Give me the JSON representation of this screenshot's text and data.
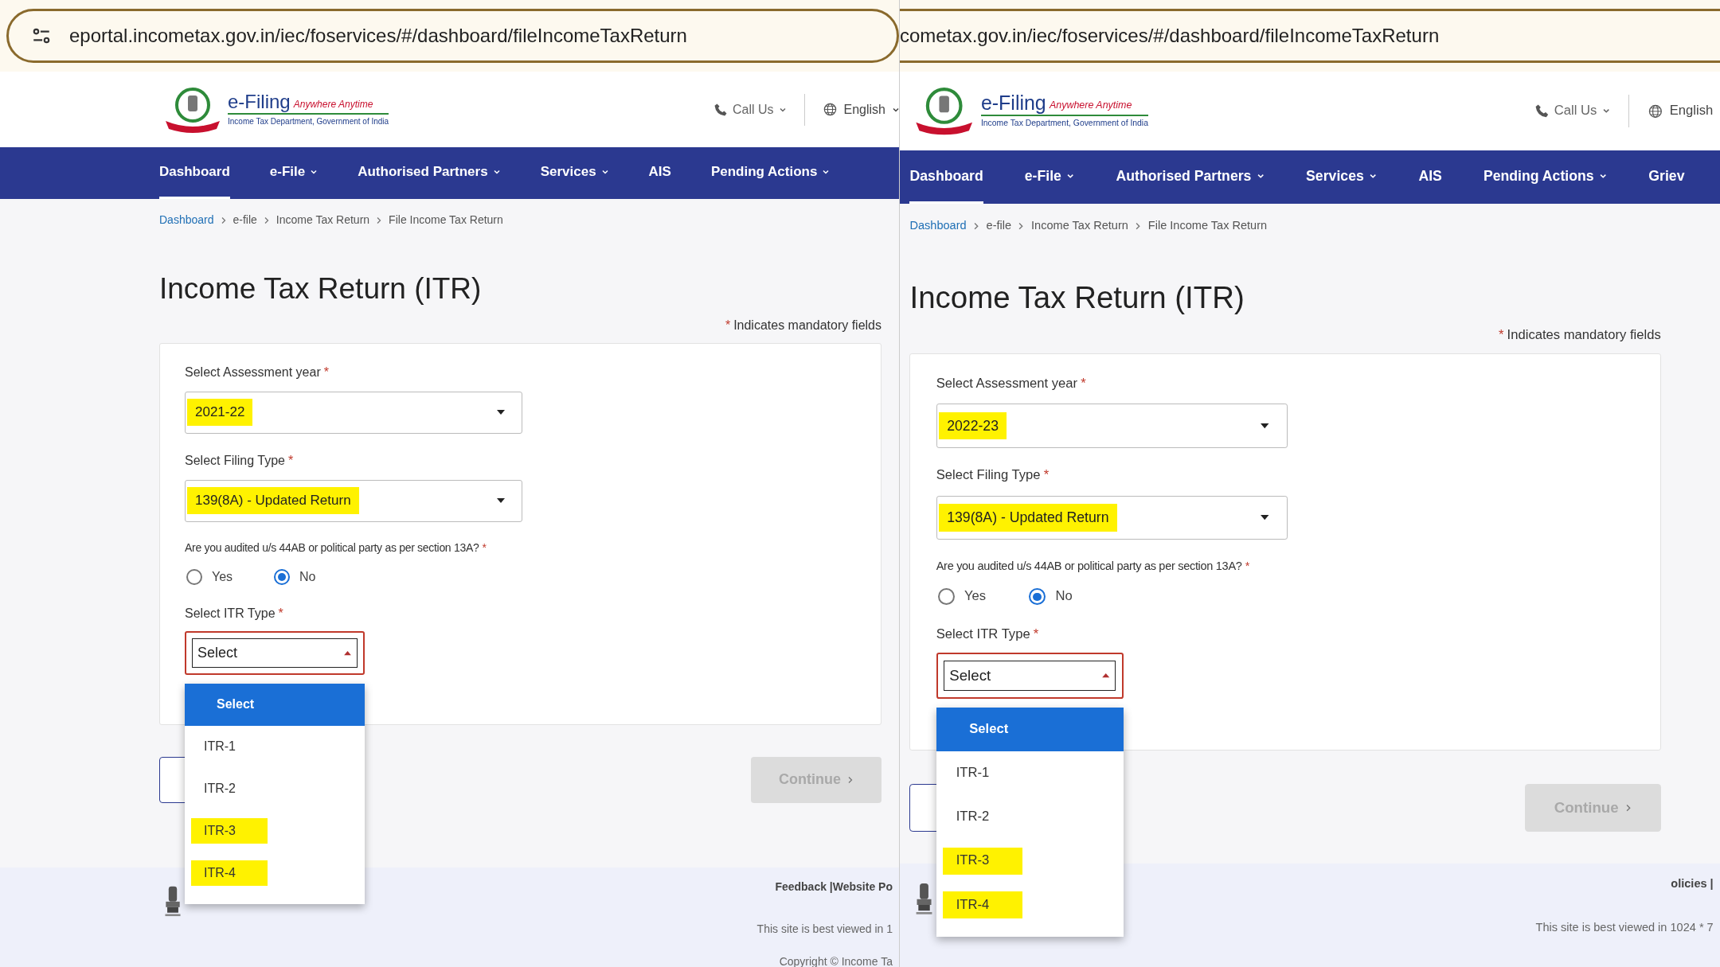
{
  "panels": [
    {
      "url": "eportal.incometax.gov.in/iec/foservices/#/dashboard/fileIncomeTaxReturn",
      "header": {
        "logo_title": "e-Filing",
        "logo_tagline": "Anywhere Anytime",
        "logo_subtitle": "Income Tax Department, Government of India",
        "call_us": "Call Us",
        "language": "English"
      },
      "nav": [
        {
          "label": "Dashboard",
          "selected": true,
          "has_menu": false
        },
        {
          "label": "e-File",
          "selected": false,
          "has_menu": true
        },
        {
          "label": "Authorised Partners",
          "selected": false,
          "has_menu": true
        },
        {
          "label": "Services",
          "selected": false,
          "has_menu": true
        },
        {
          "label": "AIS",
          "selected": false,
          "has_menu": false
        },
        {
          "label": "Pending Actions",
          "selected": false,
          "has_menu": true
        }
      ],
      "breadcrumb": [
        {
          "label": "Dashboard",
          "link": true
        },
        {
          "label": "e-file",
          "link": false
        },
        {
          "label": "Income Tax Return",
          "link": false
        },
        {
          "label": "File Income Tax Return",
          "link": false
        }
      ],
      "title": "Income Tax Return (ITR)",
      "mandatory_note": {
        "mark": "*",
        "text": "Indicates mandatory fields"
      },
      "form": {
        "assessment_year": {
          "label": "Select Assessment year",
          "mark": "*",
          "value": "2021-22",
          "highlighted": true
        },
        "filing_type": {
          "label": "Select Filing Type",
          "mark": "*",
          "value": "139(8A) - Updated Return",
          "highlighted": true
        },
        "audit_question": {
          "label": "Are you audited u/s 44AB or political party as per section 13A?",
          "mark": "*",
          "options": [
            {
              "label": "Yes",
              "selected": false
            },
            {
              "label": "No",
              "selected": true
            }
          ]
        },
        "itr_type": {
          "label": "Select ITR Type",
          "mark": "*",
          "value": "Select",
          "expanded": true,
          "options": [
            {
              "label": "Select",
              "selected": true,
              "highlighted": false
            },
            {
              "label": "ITR-1",
              "selected": false,
              "highlighted": false
            },
            {
              "label": "ITR-2",
              "selected": false,
              "highlighted": false
            },
            {
              "label": "ITR-3",
              "selected": false,
              "highlighted": true
            },
            {
              "label": "ITR-4",
              "selected": false,
              "highlighted": true
            }
          ]
        }
      },
      "continue_button": {
        "label": "Continue",
        "disabled": true
      },
      "footer": {
        "lines": [
          "Feedback |Website Po",
          "This site is best viewed in 1",
          "Copyright © Income Ta"
        ]
      }
    },
    {
      "url": "cometax.gov.in/iec/foservices/#/dashboard/fileIncomeTaxReturn",
      "header": {
        "logo_title": "e-Filing",
        "logo_tagline": "Anywhere Anytime",
        "logo_subtitle": "Income Tax Department, Government of India",
        "call_us": "Call Us",
        "language": "English"
      },
      "nav": [
        {
          "label": "Dashboard",
          "selected": true,
          "has_menu": false
        },
        {
          "label": "e-File",
          "selected": false,
          "has_menu": true
        },
        {
          "label": "Authorised Partners",
          "selected": false,
          "has_menu": true
        },
        {
          "label": "Services",
          "selected": false,
          "has_menu": true
        },
        {
          "label": "AIS",
          "selected": false,
          "has_menu": false
        },
        {
          "label": "Pending Actions",
          "selected": false,
          "has_menu": true
        },
        {
          "label": "Griev",
          "selected": false,
          "has_menu": false
        }
      ],
      "breadcrumb": [
        {
          "label": "Dashboard",
          "link": true
        },
        {
          "label": "e-file",
          "link": false
        },
        {
          "label": "Income Tax Return",
          "link": false
        },
        {
          "label": "File Income Tax Return",
          "link": false
        }
      ],
      "title": "Income Tax Return (ITR)",
      "mandatory_note": {
        "mark": "*",
        "text": "Indicates mandatory fields"
      },
      "form": {
        "assessment_year": {
          "label": "Select Assessment year",
          "mark": "*",
          "value": "2022-23",
          "highlighted": true
        },
        "filing_type": {
          "label": "Select Filing Type",
          "mark": "*",
          "value": "139(8A) - Updated Return",
          "highlighted": true
        },
        "audit_question": {
          "label": "Are you audited u/s 44AB or political party as per section 13A?",
          "mark": "*",
          "options": [
            {
              "label": "Yes",
              "selected": false
            },
            {
              "label": "No",
              "selected": true
            }
          ]
        },
        "itr_type": {
          "label": "Select ITR Type",
          "mark": "*",
          "value": "Select",
          "expanded": true,
          "options": [
            {
              "label": "Select",
              "selected": true,
              "highlighted": false
            },
            {
              "label": "ITR-1",
              "selected": false,
              "highlighted": false
            },
            {
              "label": "ITR-2",
              "selected": false,
              "highlighted": false
            },
            {
              "label": "ITR-3",
              "selected": false,
              "highlighted": true
            },
            {
              "label": "ITR-4",
              "selected": false,
              "highlighted": true
            }
          ]
        }
      },
      "continue_button": {
        "label": "Continue",
        "disabled": true
      },
      "footer": {
        "lines": [
          "olicies |",
          "This site is best viewed in 1024 * 7"
        ]
      }
    }
  ]
}
